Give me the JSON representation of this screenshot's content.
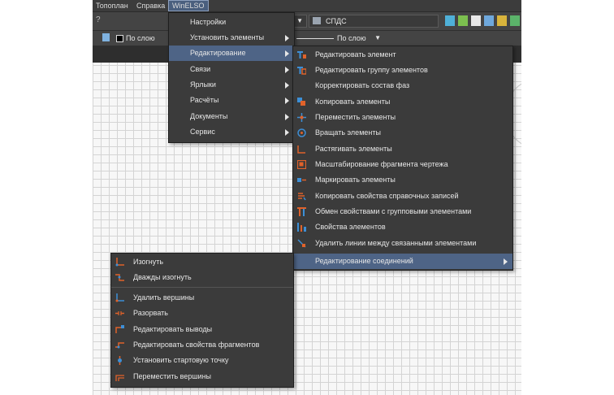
{
  "menubar": {
    "items": [
      "Топоплан",
      "Справка",
      "WinELSO"
    ]
  },
  "toolbar": {
    "help": "?",
    "layer_combo": "По слою",
    "line_combo": "По слою",
    "style_combo": "СПДС"
  },
  "winelso_menu": {
    "items": [
      {
        "label": "Настройки",
        "submenu": false
      },
      {
        "label": "Установить элементы",
        "submenu": true
      },
      {
        "label": "Редактирование",
        "submenu": true
      },
      {
        "label": "Связи",
        "submenu": true
      },
      {
        "label": "Ярлыки",
        "submenu": true
      },
      {
        "label": "Расчёты",
        "submenu": true
      },
      {
        "label": "Документы",
        "submenu": true
      },
      {
        "label": "Сервис",
        "submenu": true
      }
    ]
  },
  "edit_menu": {
    "items": [
      {
        "label": "Редактировать элемент"
      },
      {
        "label": "Редактировать группу элементов"
      },
      {
        "label": "Корректировать состав фаз"
      },
      {
        "label": "Копировать элементы"
      },
      {
        "label": "Переместить элементы"
      },
      {
        "label": "Вращать элементы"
      },
      {
        "label": "Растягивать элементы"
      },
      {
        "label": "Масштабирование фрагмента чертежа"
      },
      {
        "label": "Маркировать элементы"
      },
      {
        "label": "Копировать свойства справочных записей"
      },
      {
        "label": "Обмен свойствами с групповыми элементами"
      },
      {
        "label": "Свойства элементов"
      },
      {
        "label": "Удалить линии между связанными элементами"
      },
      {
        "label": "Редактирование соединений"
      }
    ]
  },
  "connections_menu": {
    "items": [
      {
        "label": "Изогнуть"
      },
      {
        "label": "Дважды изогнуть"
      },
      {
        "label": "Удалить вершины"
      },
      {
        "label": "Разорвать"
      },
      {
        "label": "Редактировать выводы"
      },
      {
        "label": "Редактировать свойства фрагментов"
      },
      {
        "label": "Установить стартовую точку"
      },
      {
        "label": "Переместить вершины"
      }
    ]
  },
  "colors": {
    "accent_orange": "#e0622a",
    "accent_blue": "#3d8fd6",
    "highlight": "#4e6486"
  }
}
